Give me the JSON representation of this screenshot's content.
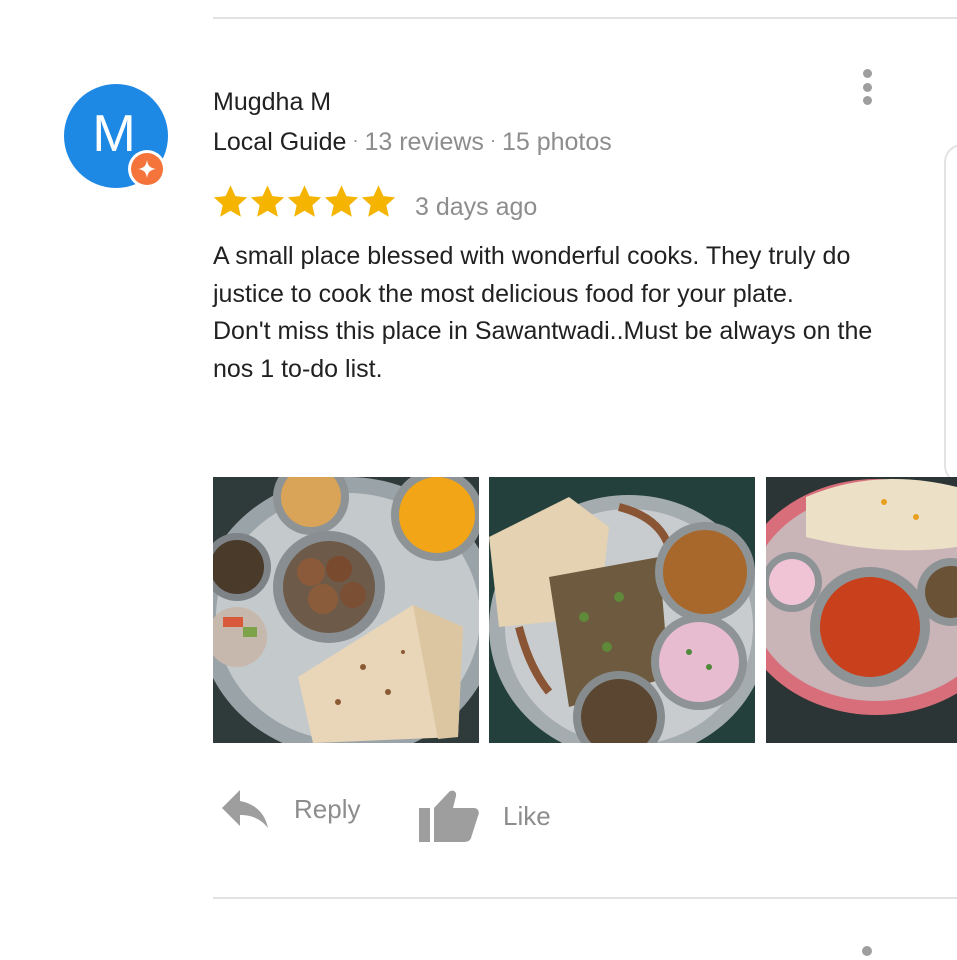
{
  "review": {
    "avatar_letter": "M",
    "author_name": "Mugdha M",
    "author_role": "Local Guide",
    "review_count": "13 reviews",
    "photo_count": "15 photos",
    "meta_separator": "·",
    "rating": 5,
    "time_ago": "3 days ago",
    "text_lines": [
      "A small place blessed with wonderful cooks. They truly do justice to cook the most delicious food for your plate.",
      "Don't miss this place in Sawantwadi..Must be always on the nos 1 to-do list."
    ]
  },
  "actions": {
    "reply_label": "Reply",
    "like_label": "Like"
  },
  "colors": {
    "avatar_bg": "#1e88e5",
    "guide_badge": "#f4743b",
    "star": "#f4b400",
    "muted_text": "#8d8d8d",
    "icon_gray": "#9e9e9e"
  }
}
